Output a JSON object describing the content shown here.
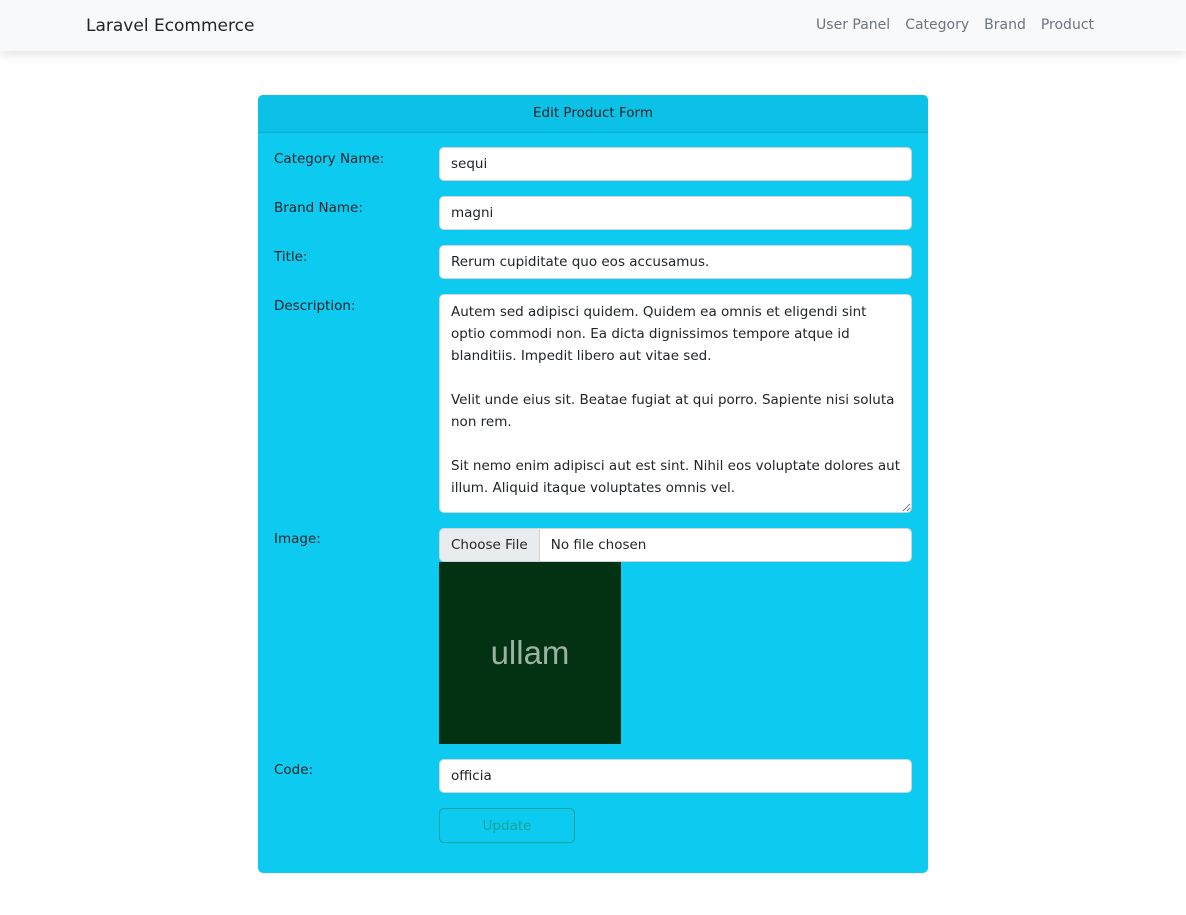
{
  "navbar": {
    "brand": "Laravel Ecommerce",
    "links": [
      "User Panel",
      "Category",
      "Brand",
      "Product"
    ]
  },
  "form": {
    "title": "Edit Product Form",
    "fields": {
      "category": {
        "label": "Category Name:",
        "value": "sequi"
      },
      "brand": {
        "label": "Brand Name:",
        "value": "magni"
      },
      "title": {
        "label": "Title:",
        "value": "Rerum cupiditate quo eos accusamus."
      },
      "description": {
        "label": "Description:",
        "value": "Autem sed adipisci quidem. Quidem ea omnis et eligendi sint optio commodi non. Ea dicta dignissimos tempore atque id blanditiis. Impedit libero aut vitae sed.\n\nVelit unde eius sit. Beatae fugiat at qui porro. Sapiente nisi soluta non rem.\n\nSit nemo enim adipisci aut est sint. Nihil eos voluptate dolores aut illum. Aliquid itaque voluptates omnis vel."
      },
      "image": {
        "label": "Image:",
        "button": "Choose File",
        "status": "No file chosen",
        "preview_text": "ullam"
      },
      "code": {
        "label": "Code:",
        "value": "officia"
      }
    },
    "submit_label": "Update"
  }
}
